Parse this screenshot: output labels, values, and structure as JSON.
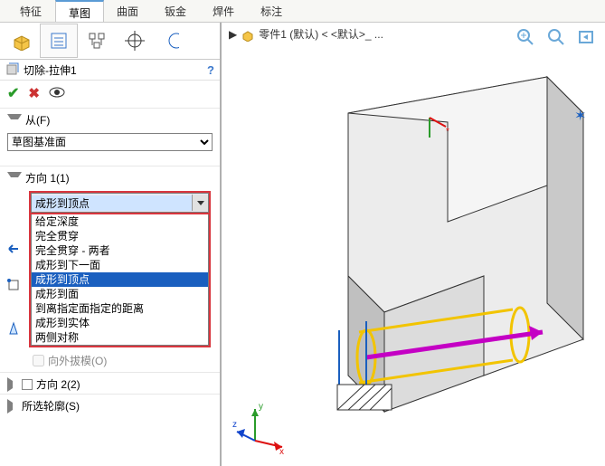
{
  "top_tabs": {
    "features": "特征",
    "sketch": "草图",
    "surface": "曲面",
    "sheetmetal": "钣金",
    "weldment": "焊件",
    "annotate": "标注"
  },
  "feature": {
    "title": "切除-拉伸1",
    "breadcrumb": "零件1 (默认) < <默认>_ ..."
  },
  "groups": {
    "from": "从(F)",
    "dir1": "方向 1(1)",
    "dir2": "方向 2(2)",
    "profile": "所选轮廓(S)"
  },
  "from_options": {
    "selected": "草图基准面"
  },
  "dir1": {
    "selected": "成形到顶点",
    "options": {
      "blind": "给定深度",
      "throughAll": "完全贯穿",
      "throughAllBoth": "完全贯穿 - 两者",
      "upToNext": "成形到下一面",
      "upToVertex": "成形到顶点",
      "upToSurface": "成形到面",
      "offsetFromSurface": "到离指定面指定的距离",
      "upToBody": "成形到实体",
      "midPlane": "两侧对称"
    },
    "draft_label": "向外拔模(O)"
  },
  "colors": {
    "accent": "#5a9bd5",
    "select": "#1a5fbf",
    "danger_frame": "#d9363e"
  },
  "axes": {
    "x": "x",
    "y": "y",
    "z": "z"
  }
}
